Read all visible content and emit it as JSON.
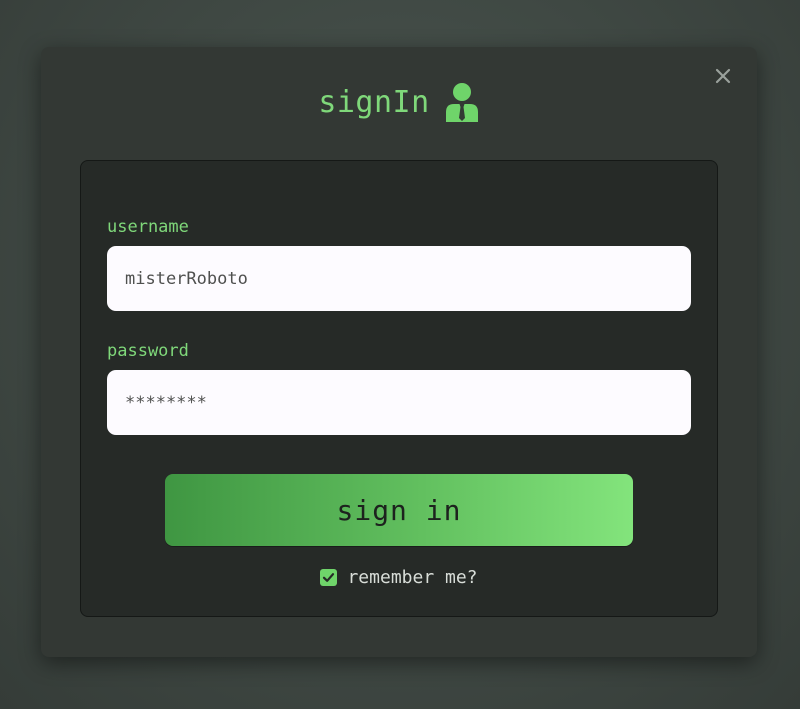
{
  "modal": {
    "title": "signIn",
    "title_icon": "user-tie-icon",
    "close_icon": "close-icon"
  },
  "form": {
    "username_label": "username",
    "username_value": "misterRoboto",
    "password_label": "password",
    "password_value": "********",
    "submit_label": "sign in",
    "remember_label": "remember me?",
    "remember_checked": true
  },
  "colors": {
    "accent": "#7fd87a",
    "modal_bg": "#333834",
    "panel_bg": "#262a27",
    "input_bg": "#fdfbff",
    "button_gradient_start": "#3f9642",
    "button_gradient_end": "#83e47c"
  }
}
